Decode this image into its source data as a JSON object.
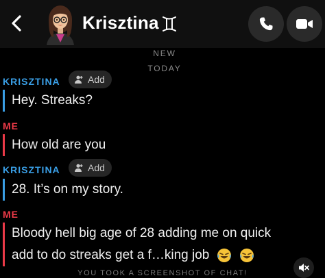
{
  "header": {
    "contact_name": "Krisztina",
    "astro_icon": "gemini-icon",
    "back_icon": "chevron-left-icon",
    "call_icon": "phone-icon",
    "video_icon": "video-camera-icon"
  },
  "dates": {
    "new": "NEW",
    "today": "TODAY"
  },
  "messages": [
    {
      "sender": "KRISZTINA",
      "add_label": "Add",
      "text": "Hey. Streaks?"
    },
    {
      "sender": "ME",
      "text": "How old are you"
    },
    {
      "sender": "KRISZTINA",
      "add_label": "Add",
      "text": "28. It’s on my story."
    },
    {
      "sender": "ME",
      "line1": "Bloody hell big age of 28 adding me on quick",
      "line2": "add to do streaks get a f…king job"
    }
  ],
  "footer": {
    "screenshot_note": "YOU TOOK A SCREENSHOT OF CHAT!",
    "mute_icon": "speaker-muted-icon"
  },
  "colors": {
    "friend": "#3a9fe6",
    "me": "#ec3a48",
    "background": "#000000",
    "header": "#101010"
  }
}
